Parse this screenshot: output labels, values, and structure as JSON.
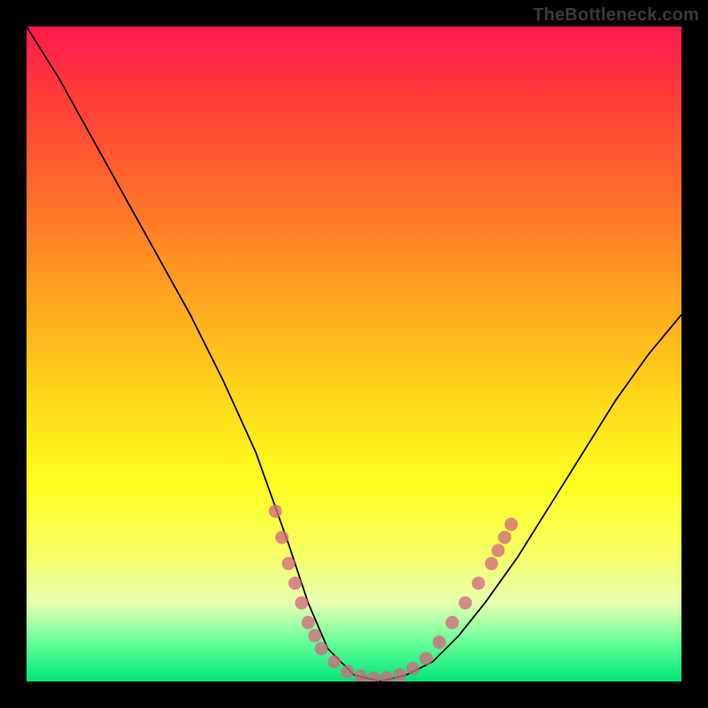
{
  "watermark": "TheBottleneck.com",
  "chart_data": {
    "type": "line",
    "title": "",
    "xlabel": "",
    "ylabel": "",
    "xlim": [
      0,
      100
    ],
    "ylim": [
      0,
      100
    ],
    "grid": false,
    "legend": false,
    "series": [
      {
        "name": "curve",
        "x": [
          0,
          5,
          10,
          15,
          20,
          25,
          30,
          35,
          40,
          43,
          46,
          50,
          54,
          58,
          62,
          66,
          70,
          75,
          80,
          85,
          90,
          95,
          100
        ],
        "y": [
          100,
          92,
          83,
          74,
          65,
          56,
          46,
          35,
          21,
          12,
          5,
          1,
          0,
          1,
          3,
          7,
          12,
          19,
          27,
          35,
          43,
          50,
          56
        ]
      }
    ],
    "scatter_points": {
      "name": "highlight-dots",
      "points": [
        {
          "x": 38,
          "y": 26
        },
        {
          "x": 39,
          "y": 22
        },
        {
          "x": 40,
          "y": 18
        },
        {
          "x": 41,
          "y": 15
        },
        {
          "x": 42,
          "y": 12
        },
        {
          "x": 43,
          "y": 9
        },
        {
          "x": 44,
          "y": 7
        },
        {
          "x": 45,
          "y": 5
        },
        {
          "x": 47,
          "y": 3
        },
        {
          "x": 49,
          "y": 1.5
        },
        {
          "x": 51,
          "y": 0.8
        },
        {
          "x": 53,
          "y": 0.5
        },
        {
          "x": 55,
          "y": 0.6
        },
        {
          "x": 57,
          "y": 1
        },
        {
          "x": 59,
          "y": 2
        },
        {
          "x": 61,
          "y": 3.5
        },
        {
          "x": 63,
          "y": 6
        },
        {
          "x": 65,
          "y": 9
        },
        {
          "x": 67,
          "y": 12
        },
        {
          "x": 69,
          "y": 15
        },
        {
          "x": 71,
          "y": 18
        },
        {
          "x": 72,
          "y": 20
        },
        {
          "x": 73,
          "y": 22
        },
        {
          "x": 74,
          "y": 24
        }
      ]
    },
    "background_gradient": {
      "top": "#ff1a4d",
      "mid": "#ffd21a",
      "bottom": "#00e676"
    }
  }
}
